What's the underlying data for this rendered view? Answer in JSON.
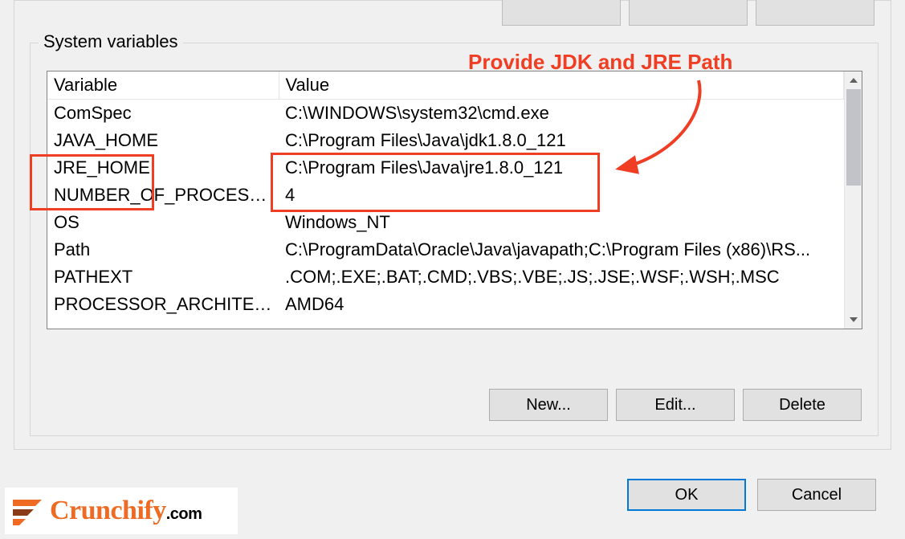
{
  "section_title": "System variables",
  "table": {
    "headers": {
      "variable": "Variable",
      "value": "Value"
    },
    "rows": [
      {
        "variable": "ComSpec",
        "value": "C:\\WINDOWS\\system32\\cmd.exe"
      },
      {
        "variable": "JAVA_HOME",
        "value": "C:\\Program Files\\Java\\jdk1.8.0_121"
      },
      {
        "variable": "JRE_HOME",
        "value": "C:\\Program Files\\Java\\jre1.8.0_121"
      },
      {
        "variable": "NUMBER_OF_PROCESSORS",
        "value": "4"
      },
      {
        "variable": "OS",
        "value": "Windows_NT"
      },
      {
        "variable": "Path",
        "value": "C:\\ProgramData\\Oracle\\Java\\javapath;C:\\Program Files (x86)\\RS..."
      },
      {
        "variable": "PATHEXT",
        "value": ".COM;.EXE;.BAT;.CMD;.VBS;.VBE;.JS;.JSE;.WSF;.WSH;.MSC"
      },
      {
        "variable": "PROCESSOR_ARCHITECTURE",
        "value": "AMD64"
      }
    ]
  },
  "buttons": {
    "new": "New...",
    "edit": "Edit...",
    "delete": "Delete",
    "ok": "OK",
    "cancel": "Cancel"
  },
  "annotation": {
    "label": "Provide JDK and JRE Path",
    "color": "#ef3e24"
  },
  "logo": {
    "brand": "Crunchify",
    "suffix": ".com"
  }
}
